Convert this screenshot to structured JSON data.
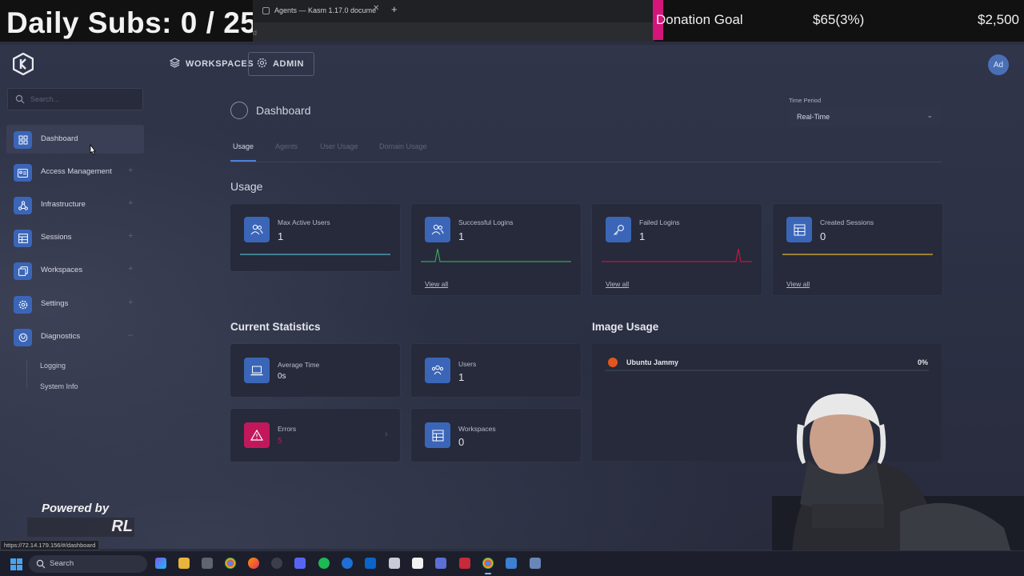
{
  "overlay": {
    "daily_subs": "Daily Subs:  0 / 25",
    "donation_label": "Donation Goal",
    "donation_amount": "$65(3%)",
    "donation_goal": "$2,500",
    "browser_tab_title": "Agents — Kasm 1.17.0 docume",
    "browser_url_fragment": "d"
  },
  "topnav": {
    "workspaces_label": "WORKSPACES",
    "admin_label": "ADMIN",
    "avatar_initials": "Ad"
  },
  "sidebar": {
    "search_placeholder": "Search...",
    "items": [
      {
        "label": "Dashboard",
        "icon": "dashboard-icon",
        "active": true
      },
      {
        "label": "Access Management",
        "icon": "id-card-icon"
      },
      {
        "label": "Infrastructure",
        "icon": "network-icon"
      },
      {
        "label": "Sessions",
        "icon": "table-icon"
      },
      {
        "label": "Workspaces",
        "icon": "layers-icon"
      },
      {
        "label": "Settings",
        "icon": "gear-icon"
      },
      {
        "label": "Diagnostics",
        "icon": "stethoscope-icon",
        "expanded": true
      }
    ],
    "diagnostics_sub": [
      "Logging",
      "System Info"
    ]
  },
  "page": {
    "title": "Dashboard",
    "time_period_label": "Time Period",
    "time_period_value": "Real-Time",
    "tabs": [
      "Usage",
      "Agents",
      "User Usage",
      "Domain Usage"
    ],
    "active_tab": "Usage"
  },
  "usage": {
    "title": "Usage",
    "cards": [
      {
        "title": "Max Active Users",
        "value": "1",
        "icon": "users-icon",
        "line_color": "#4fb0c6",
        "view_all": ""
      },
      {
        "title": "Successful Logins",
        "value": "1",
        "icon": "users-icon",
        "line_color": "#3aa15a",
        "view_all": "View all"
      },
      {
        "title": "Failed Logins",
        "value": "1",
        "icon": "key-icon",
        "line_color": "#c0183b",
        "view_all": "View all"
      },
      {
        "title": "Created Sessions",
        "value": "0",
        "icon": "table-icon",
        "line_color": "#e2b43a",
        "view_all": "View all"
      }
    ]
  },
  "current_statistics": {
    "title": "Current Statistics",
    "cards": [
      {
        "title": "Average Time",
        "value": "0s",
        "icon": "laptop-icon"
      },
      {
        "title": "Users",
        "value": "1",
        "icon": "users-icon"
      },
      {
        "title": "Errors",
        "value": "5",
        "icon": "warning-icon",
        "accent": "#c2185b"
      },
      {
        "title": "Workspaces",
        "value": "0",
        "icon": "table-icon"
      }
    ]
  },
  "image_usage": {
    "title": "Image Usage",
    "items": [
      {
        "name": "Ubuntu Jammy",
        "percent": "0%",
        "icon": "ubuntu-icon"
      }
    ]
  },
  "footer": {
    "powered_by": "Powered by",
    "powered_logo": "RL",
    "status_url": "https://72.14.179.156/#/dashboard"
  },
  "taskbar": {
    "search_label": "Search"
  },
  "colors": {
    "accent_blue": "#3b66b8",
    "error_pink": "#c2185b",
    "donation_pink": "#d4157a"
  }
}
